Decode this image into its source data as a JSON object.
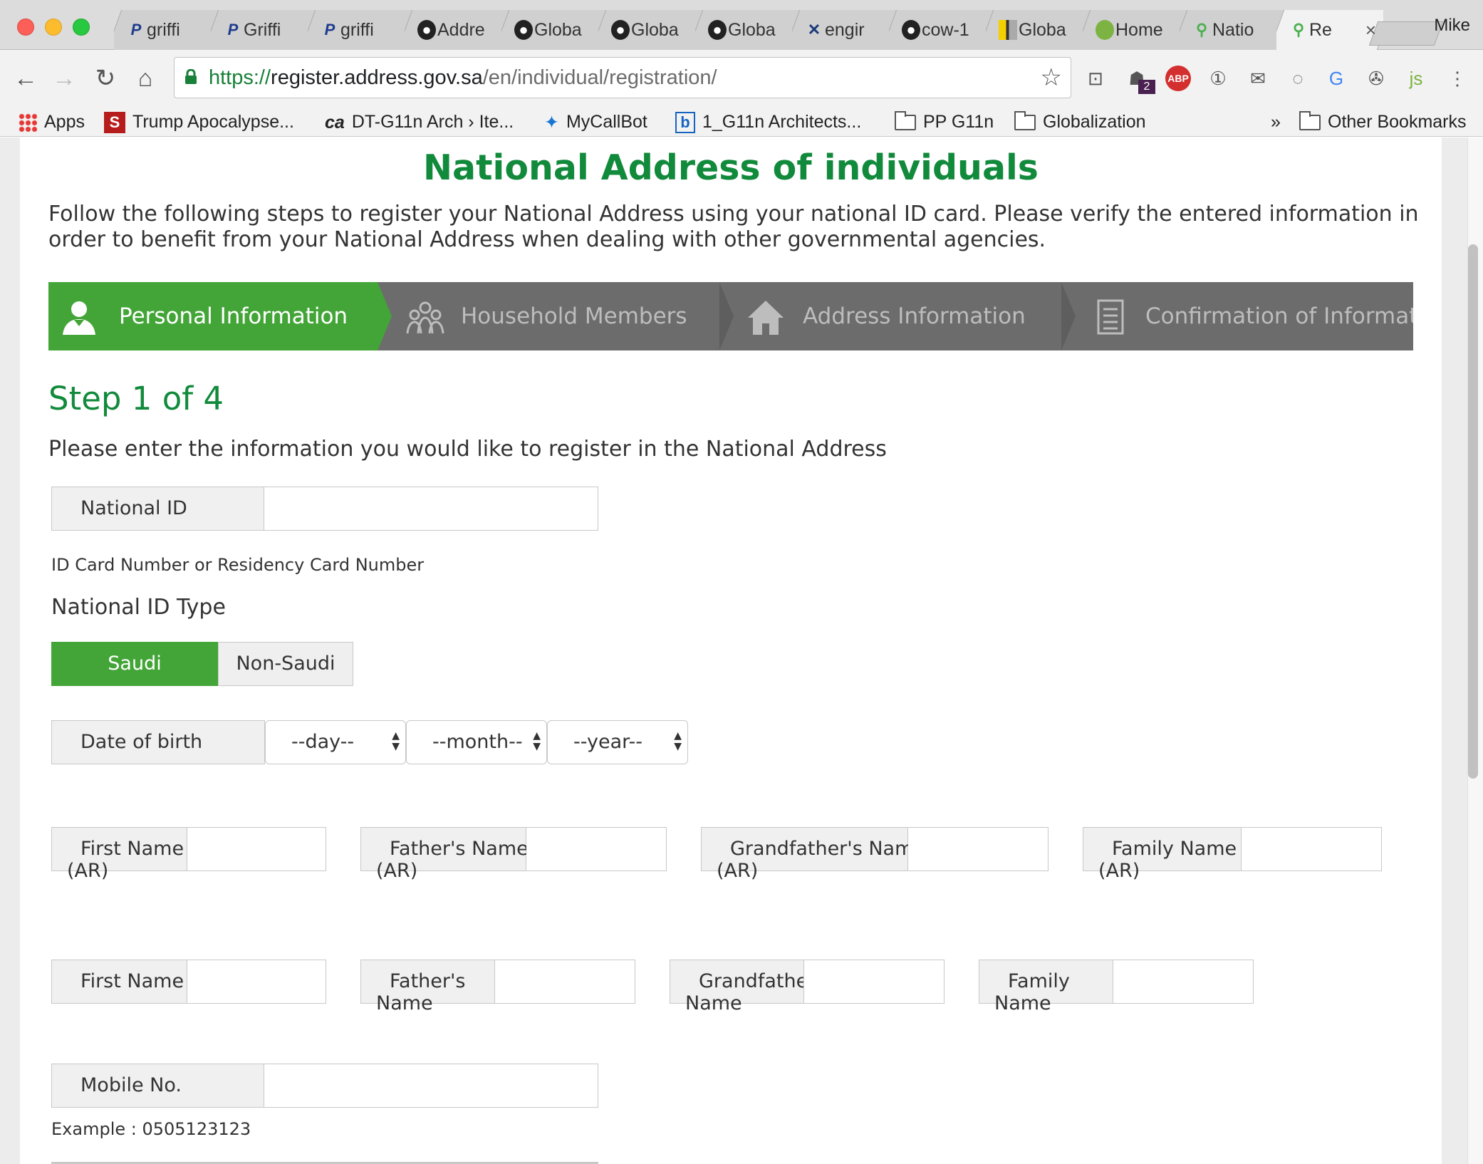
{
  "browser": {
    "tabs": [
      {
        "favicon": "paypal-icon",
        "label": "griffi"
      },
      {
        "favicon": "paypal-icon",
        "label": "Griffi"
      },
      {
        "favicon": "paypal-icon",
        "label": "griffi"
      },
      {
        "favicon": "github-icon",
        "label": "Addre"
      },
      {
        "favicon": "github-icon",
        "label": "Globa"
      },
      {
        "favicon": "github-icon",
        "label": "Globa"
      },
      {
        "favicon": "github-icon",
        "label": "Globa"
      },
      {
        "favicon": "x-tools-icon",
        "label": "engir"
      },
      {
        "favicon": "github-icon",
        "label": "cow-1"
      },
      {
        "favicon": "yellow-doc-icon",
        "label": "Globa"
      },
      {
        "favicon": "home-globe-icon",
        "label": "Home"
      },
      {
        "favicon": "map-pin-icon",
        "label": "Natio"
      },
      {
        "favicon": "map-pin-icon",
        "label": "Re"
      }
    ],
    "profile": "Mike",
    "url": {
      "scheme": "https://",
      "host": "register.address.gov.sa",
      "path": "/en/individual/registration/"
    },
    "extension_badge": "2",
    "bookmarks": [
      {
        "icon": "apps-grid-icon",
        "label": "Apps"
      },
      {
        "icon": "s-logo-icon",
        "label": "Trump Apocalypse..."
      },
      {
        "icon": "ca-logo-icon",
        "label": "DT-G11n Arch › Ite..."
      },
      {
        "icon": "bot-icon",
        "label": "MyCallBot"
      },
      {
        "icon": "b-logo-icon",
        "label": "1_G11n Architects..."
      },
      {
        "icon": "folder-icon",
        "label": "PP G11n"
      },
      {
        "icon": "folder-icon",
        "label": "Globalization"
      }
    ],
    "bookmarks_overflow": "»",
    "other_bookmarks": "Other Bookmarks"
  },
  "page": {
    "title": "National Address of individuals",
    "intro": "Follow the following steps to register your National Address using your national ID card. Please verify the entered information in order to benefit from your National Address when dealing with other governmental agencies.",
    "steps": [
      {
        "label": "Personal Information",
        "icon": "user-icon"
      },
      {
        "label": "Household Members",
        "icon": "group-icon"
      },
      {
        "label": "Address Information",
        "icon": "house-icon"
      },
      {
        "label": "Confirmation of Information",
        "icon": "document-icon"
      }
    ],
    "step_heading": "Step 1 of 4",
    "lead": "Please enter the information you would like to register in the National Address",
    "national_id": {
      "label": "National ID",
      "value": "",
      "hint": "ID Card Number or Residency Card Number"
    },
    "id_type": {
      "label": "National ID Type",
      "options": [
        "Saudi",
        "Non-Saudi"
      ],
      "selected": "Saudi"
    },
    "dob": {
      "label": "Date of birth",
      "day": "--day--",
      "month": "--month--",
      "year": "--year--"
    },
    "names_ar": {
      "first": "First Name",
      "father": "Father's Name",
      "grandfather": "Grandfather's Name",
      "family": "Family Name",
      "suffix": "(AR)"
    },
    "names_en": {
      "first": "First Name",
      "father_1": "Father's",
      "father_2": "Name",
      "grandfather_1": "Grandfather's",
      "grandfather_2": "Name",
      "family_1": "Family",
      "family_2": "Name"
    },
    "mobile": {
      "label": "Mobile No.",
      "value": "",
      "example": "Example : 0505123123"
    }
  },
  "colors": {
    "brand_green": "#118a3b",
    "step_active": "#43a537",
    "step_bar": "#6c6c6c"
  }
}
